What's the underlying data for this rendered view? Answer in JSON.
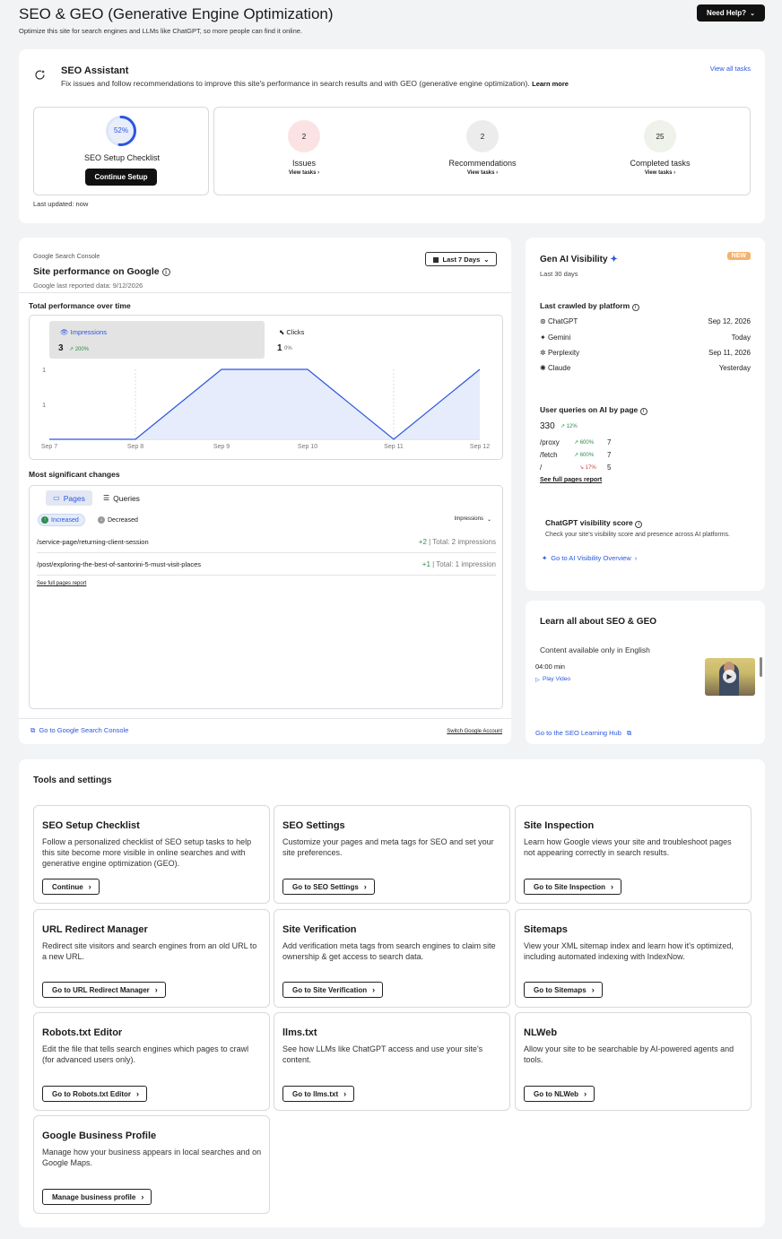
{
  "header": {
    "title": "SEO & GEO (Generative Engine Optimization)",
    "subtitle": "Optimize this site for search engines and LLMs like ChatGPT, so more people can find it online.",
    "help_button": "Need Help?"
  },
  "assistant": {
    "title": "SEO Assistant",
    "description": "Fix issues and follow recommendations to improve this site's performance in search results and with GEO (generative engine optimization).",
    "learn_more": "Learn more",
    "view_all": "View all tasks",
    "checklist_percent": "52%",
    "checklist_progress": 0.52,
    "checklist_label": "SEO Setup Checklist",
    "continue_button": "Continue Setup",
    "last_updated": "Last updated: now",
    "stats": [
      {
        "count": "2",
        "label": "Issues",
        "link": "View tasks"
      },
      {
        "count": "2",
        "label": "Recommendations",
        "link": "View tasks"
      },
      {
        "count": "25",
        "label": "Completed tasks",
        "link": "View tasks"
      }
    ]
  },
  "performance": {
    "brand": "Google Search Console",
    "title": "Site performance on Google",
    "reported": "Google last reported data: 9/12/2026",
    "range": "Last 7 Days",
    "section_title": "Total performance over time",
    "impressions": {
      "label": "Impressions",
      "value": "3",
      "change": "200%"
    },
    "clicks": {
      "label": "Clicks",
      "value": "1",
      "change": "0%"
    },
    "changes_title": "Most significant changes",
    "tab_pages": "Pages",
    "tab_queries": "Queries",
    "filter_increased": "Increased",
    "filter_decreased": "Decreased",
    "sort": "Impressions",
    "rows": [
      {
        "path": "/service-page/returning-client-session",
        "delta": "+2",
        "total": "| Total: 2 impressions"
      },
      {
        "path": "/post/exploring-the-best-of-santorini-5-must-visit-places",
        "delta": "+1",
        "total": "| Total: 1 impression"
      }
    ],
    "see_full": "See full pages report",
    "console_link": "Go to Google Search Console",
    "switch_account": "Switch Google Account"
  },
  "chart_data": {
    "type": "area",
    "title": "Total performance over time",
    "categories": [
      "Sep 7",
      "Sep 8",
      "Sep 9",
      "Sep 10",
      "Sep 11",
      "Sep 12"
    ],
    "y_ticks": [
      "1",
      "1"
    ],
    "series": [
      {
        "name": "Impressions",
        "values": [
          0,
          0,
          1,
          1,
          0,
          1
        ]
      }
    ],
    "ylim": [
      0,
      1
    ]
  },
  "geo": {
    "title": "Gen AI Visibility",
    "badge": "NEW",
    "period": "Last 30 days",
    "crawled_title": "Last crawled by platform",
    "platforms": [
      {
        "name": "ChatGPT",
        "date": "Sep 12, 2026"
      },
      {
        "name": "Gemini",
        "date": "Today"
      },
      {
        "name": "Perplexity",
        "date": "Sep 11, 2026"
      },
      {
        "name": "Claude",
        "date": "Yesterday"
      }
    ],
    "queries_title": "User queries on AI by page",
    "queries_total": "330",
    "queries_change": "12%",
    "pages": [
      {
        "path": "/proxy",
        "change": "600%",
        "count": "7",
        "dir": "up"
      },
      {
        "path": "/fetch",
        "change": "600%",
        "count": "7",
        "dir": "up"
      },
      {
        "path": "/",
        "change": "17%",
        "count": "5",
        "dir": "down"
      }
    ],
    "see_full": "See full pages report",
    "score_title": "ChatGPT visibility score",
    "score_desc": "Check your site's visibility score and presence across AI platforms.",
    "score_link": "Go to AI Visibility Overview"
  },
  "learn": {
    "title": "Learn all about SEO & GEO",
    "note": "Content available only in English",
    "duration": "04:00 min",
    "play": "Play Video",
    "hub_link": "Go to the SEO Learning Hub"
  },
  "tools": {
    "title": "Tools and settings",
    "items": [
      {
        "title": "SEO Setup Checklist",
        "desc": "Follow a personalized checklist of SEO setup tasks to help this site become more visible in online searches and with generative engine optimization (GEO).",
        "button": "Continue"
      },
      {
        "title": "SEO Settings",
        "desc": "Customize your pages and meta tags for SEO and set your site preferences.",
        "button": "Go to SEO Settings"
      },
      {
        "title": "Site Inspection",
        "desc": "Learn how Google views your site and troubleshoot pages not appearing correctly in search results.",
        "button": "Go to Site Inspection"
      },
      {
        "title": "URL Redirect Manager",
        "desc": "Redirect site visitors and search engines from an old URL to a new URL.",
        "button": "Go to URL Redirect Manager"
      },
      {
        "title": "Site Verification",
        "desc": "Add verification meta tags from search engines to claim site ownership & get access to search data.",
        "button": "Go to Site Verification"
      },
      {
        "title": "Sitemaps",
        "desc": "View your XML sitemap index and learn how it's optimized, including automated indexing with IndexNow.",
        "button": "Go to Sitemaps"
      },
      {
        "title": "Robots.txt Editor",
        "desc": "Edit the file that tells search engines which pages to crawl (for advanced users only).",
        "button": "Go to Robots.txt Editor"
      },
      {
        "title": "llms.txt",
        "desc": "See how LLMs like ChatGPT access and use your site's content.",
        "button": "Go to llms.txt"
      },
      {
        "title": "NLWeb",
        "desc": "Allow your site to be searchable by AI-powered agents and tools.",
        "button": "Go to NLWeb"
      },
      {
        "title": "Google Business Profile",
        "desc": "Manage how your business appears in local searches and on Google Maps.",
        "button": "Manage business profile"
      }
    ]
  },
  "colors": {
    "accent": "#2b57e0",
    "positive": "#2e8b4e",
    "negative": "#d23b3b",
    "badge": "#f59e3b"
  }
}
